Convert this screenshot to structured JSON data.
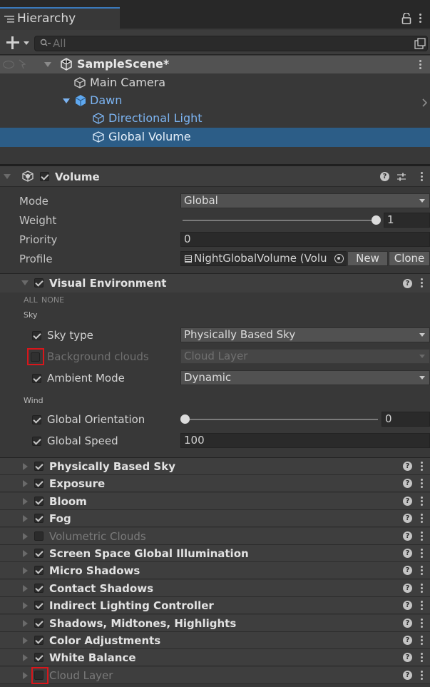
{
  "hierarchy": {
    "tab_label": "Hierarchy",
    "search_placeholder": "All",
    "scene_name": "SampleScene*",
    "items": [
      "Main Camera",
      "Dawn",
      "Directional Light",
      "Global Volume"
    ]
  },
  "volume": {
    "title": "Volume",
    "mode_label": "Mode",
    "mode_value": "Global",
    "weight_label": "Weight",
    "weight_value": "1",
    "priority_label": "Priority",
    "priority_value": "0",
    "profile_label": "Profile",
    "profile_value": "NightGlobalVolume (Volu",
    "new_label": "New",
    "clone_label": "Clone"
  },
  "visual_env": {
    "title": "Visual Environment",
    "all_label": "ALL",
    "none_label": "NONE",
    "sky_section": "Sky",
    "sky_type_label": "Sky type",
    "sky_type_value": "Physically Based Sky",
    "bg_clouds_label": "Background clouds",
    "bg_clouds_value": "Cloud Layer",
    "ambient_label": "Ambient Mode",
    "ambient_value": "Dynamic",
    "wind_section": "Wind",
    "orientation_label": "Global Orientation",
    "orientation_value": "0",
    "speed_label": "Global Speed",
    "speed_value": "100"
  },
  "overrides": [
    {
      "label": "Physically Based Sky",
      "enabled": true
    },
    {
      "label": "Exposure",
      "enabled": true
    },
    {
      "label": "Bloom",
      "enabled": true
    },
    {
      "label": "Fog",
      "enabled": true
    },
    {
      "label": "Volumetric Clouds",
      "enabled": false
    },
    {
      "label": "Screen Space Global Illumination",
      "enabled": true
    },
    {
      "label": "Micro Shadows",
      "enabled": true
    },
    {
      "label": "Contact Shadows",
      "enabled": true
    },
    {
      "label": "Indirect Lighting Controller",
      "enabled": true
    },
    {
      "label": "Shadows, Midtones, Highlights",
      "enabled": true
    },
    {
      "label": "Color Adjustments",
      "enabled": true
    },
    {
      "label": "White Balance",
      "enabled": true
    },
    {
      "label": "Cloud Layer",
      "enabled": false
    }
  ],
  "colors": {
    "selection": "#2c5d87",
    "highlight_box": "#d9161b",
    "prefab_blue": "#7cb4f2"
  }
}
